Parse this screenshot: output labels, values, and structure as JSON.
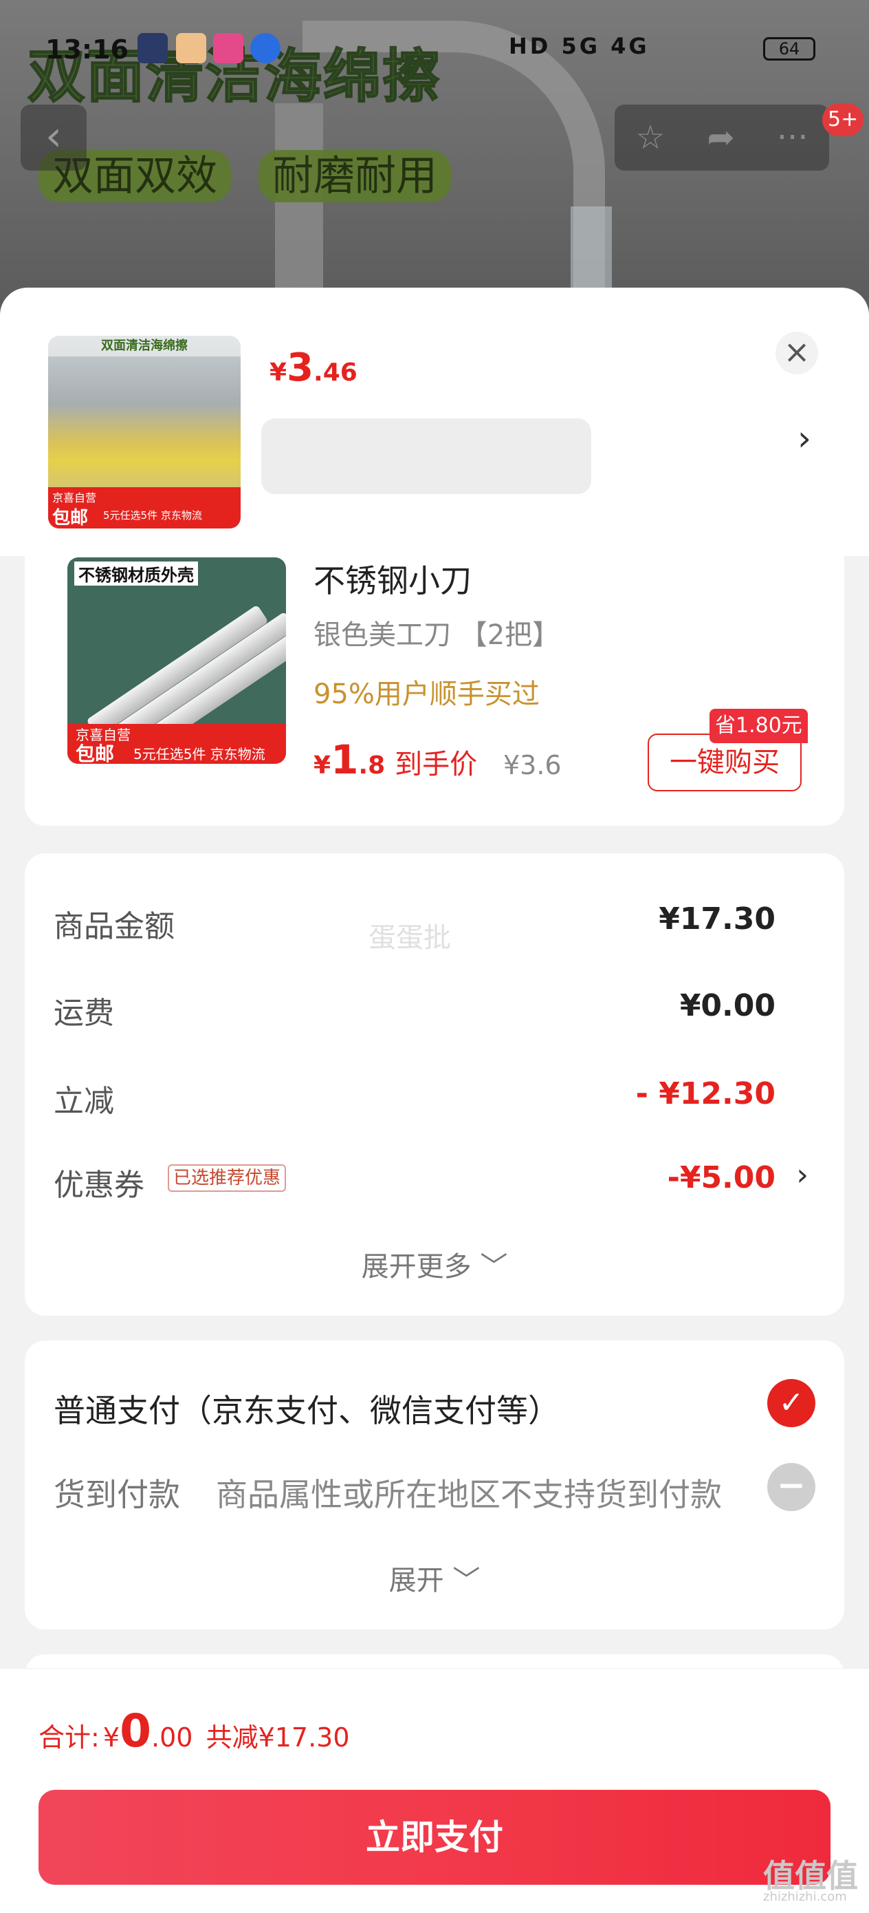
{
  "status_bar": {
    "time": "13:16",
    "system": "HD 5G 4G",
    "battery": "64"
  },
  "background": {
    "title": "双面清洁海绵擦",
    "tags": [
      "双面双效",
      "耐磨耐用"
    ],
    "badge": "5+"
  },
  "sheet_header": {
    "price_currency": "¥",
    "price_int": "3",
    "price_dec": ".46",
    "thumb_banner": "双面清洁海绵擦",
    "thumb_foot_a": "京喜自营",
    "thumb_foot_b": "包邮",
    "thumb_foot_c": "5元任选5件 京东物流"
  },
  "product": {
    "title": "不锈钢小刀",
    "spec": "银色美工刀 【2把】",
    "hot": "95%用户顺手买过",
    "price_currency": "¥",
    "price_int": "1",
    "price_dec": ".8",
    "price_label": "到手价",
    "original_price": "¥3.6",
    "buy_label": "一键购买",
    "save_tag": "省1.80元",
    "img_caption": "不锈钢材质外壳",
    "img_foot_a": "京喜自营",
    "img_foot_b": "包邮",
    "img_foot_c": "5元任选5件 京东物流"
  },
  "summary": {
    "watermark": "蛋蛋批",
    "rows": [
      {
        "label": "商品金额",
        "value": "¥17.30"
      },
      {
        "label": "运费",
        "value": "¥0.00"
      },
      {
        "label": "立减",
        "value": "- ¥12.30"
      },
      {
        "label": "优惠券",
        "value": "-¥5.00"
      }
    ],
    "coupon_tag": "已选推荐优惠",
    "expand_more": "展开更多 ﹀"
  },
  "payment": {
    "normal": "普通支付（京东支付、微信支付等）",
    "cod": "货到付款",
    "cod_note": "商品属性或所在地区不支持货到付款",
    "expand": "展开 ﹀"
  },
  "footer": {
    "total_label": "合计:",
    "total_currency": "¥",
    "total_int": "0",
    "total_dec": ".00",
    "total_cut": "共减¥17.30",
    "pay_button": "立即支付"
  },
  "site_watermark": {
    "logo": "值值值",
    "url": "zhizhizhi.com"
  },
  "colors": {
    "accent": "#e4231f",
    "button": "#f23a4a"
  }
}
